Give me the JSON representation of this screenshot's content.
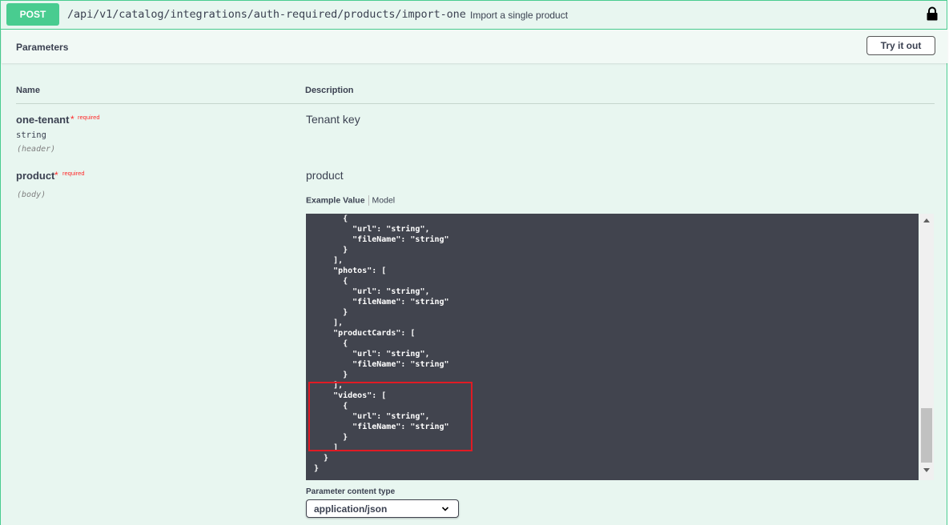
{
  "operation": {
    "method": "POST",
    "path": "/api/v1/catalog/integrations/auth-required/products/import-one",
    "summary": "Import a single product"
  },
  "parameters_section": {
    "title": "Parameters",
    "try_button_label": "Try it out"
  },
  "table": {
    "col_name": "Name",
    "col_description": "Description"
  },
  "params": [
    {
      "name": "one-tenant",
      "required_star": "*",
      "required_label": "required",
      "type": "string",
      "in": "(header)",
      "description": "Tenant key"
    },
    {
      "name": "product",
      "required_star": "*",
      "required_label": "required",
      "in": "(body)",
      "description": "product"
    }
  ],
  "example_tabs": {
    "active": "Example Value",
    "other": "Model"
  },
  "example_code": "      {\n        \"url\": \"string\",\n        \"fileName\": \"string\"\n      }\n    ],\n    \"photos\": [\n      {\n        \"url\": \"string\",\n        \"fileName\": \"string\"\n      }\n    ],\n    \"productCards\": [\n      {\n        \"url\": \"string\",\n        \"fileName\": \"string\"\n      }\n    ],\n    \"videos\": [\n      {\n        \"url\": \"string\",\n        \"fileName\": \"string\"\n      }\n    ]\n  }\n}",
  "content_type": {
    "label": "Parameter content type",
    "selected": "application/json"
  },
  "colors": {
    "post_green": "#49cc90",
    "panel_bg": "#e8f6f0",
    "code_bg": "#41444e",
    "required_red": "#ff2a2a",
    "highlight_red": "#e01b24"
  }
}
